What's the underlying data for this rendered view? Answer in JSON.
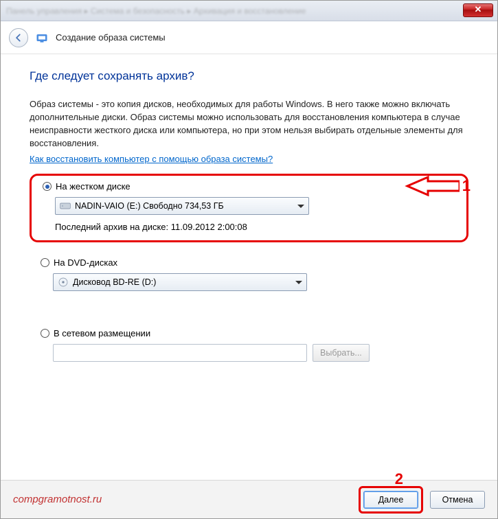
{
  "titlebar": {
    "breadcrumb": "Панель управления  ▸  Система и безопасность  ▸  Архивация и восстановление"
  },
  "header": {
    "title": "Создание образа системы"
  },
  "main": {
    "question": "Где следует сохранять архив?",
    "description": "Образ системы - это копия дисков, необходимых для работы Windows. В него также можно включать дополнительные диски. Образ системы можно использовать для восстановления компьютера в случае неисправности жесткого диска или компьютера, но при этом нельзя выбирать отдельные элементы для восстановления.",
    "help_link": "Как восстановить компьютер с помощью образа системы?",
    "options": {
      "hard_disk": {
        "label": "На жестком диске",
        "dropdown_text": "NADIN-VAIO (E:)  Свободно 734,53 ГБ",
        "last_archive_label": "Последний архив на диске:",
        "last_archive_value": "11.09.2012 2:00:08"
      },
      "dvd": {
        "label": "На DVD-дисках",
        "dropdown_text": "Дисковод BD-RE (D:)"
      },
      "network": {
        "label": "В сетевом размещении",
        "input_value": "",
        "browse_label": "Выбрать..."
      }
    }
  },
  "annotations": {
    "marker1": "1",
    "marker2": "2"
  },
  "footer": {
    "watermark": "compgramotnost.ru",
    "next": "Далее",
    "cancel": "Отмена"
  }
}
